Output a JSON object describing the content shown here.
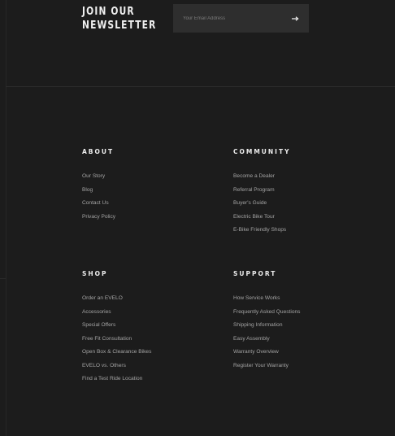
{
  "newsletter": {
    "title_line1": "JOIN OUR",
    "title_line2": "NEWSLETTER",
    "email_placeholder": "Your Email Address"
  },
  "footer": {
    "about": {
      "heading": "ABOUT",
      "links": [
        "Our Story",
        "Blog",
        "Contact Us",
        "Privacy Policy"
      ]
    },
    "community": {
      "heading": "COMMUNITY",
      "links": [
        "Become a Dealer",
        "Referral Program",
        "Buyer's Guide",
        "Electric Bike Tour",
        "E-Bike Friendly Shops"
      ]
    },
    "shop": {
      "heading": "SHOP",
      "links": [
        "Order an EVELO",
        "Accessories",
        "Special Offers",
        "Free Fit Consultation",
        "Open Box & Clearance Bikes",
        "EVELO vs. Others",
        "Find a Test Ride Location"
      ]
    },
    "support": {
      "heading": "SUPPORT",
      "links": [
        "How Service Works",
        "Frequently Asked Questions",
        "Shipping Information",
        "Easy Assembly",
        "Warranty Overview",
        "Register Your Warranty"
      ]
    }
  },
  "icons": {
    "submit": "arrow-right-icon"
  },
  "colors": {
    "background": "#1c1c1c",
    "heading": "#ececec",
    "link": "#a4a4a4",
    "input_bg": "#2e2e2e"
  }
}
